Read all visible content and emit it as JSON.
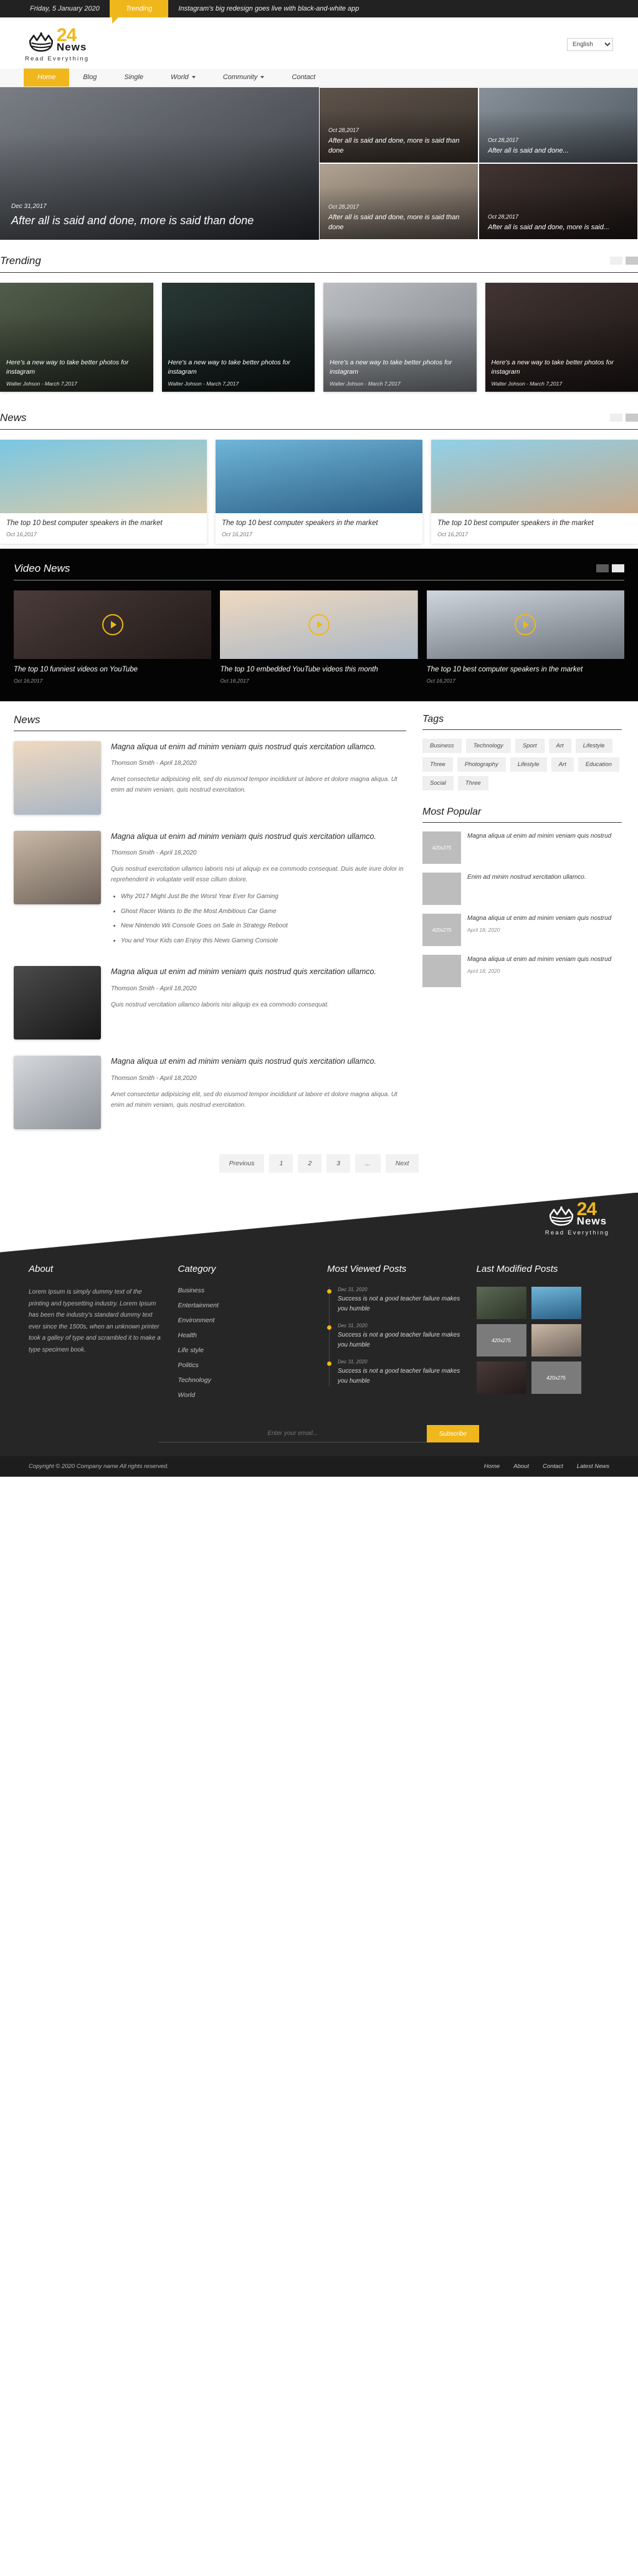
{
  "topbar": {
    "date": "Friday, 5 January 2020",
    "trending_label": "Trending",
    "headline": "Instagram's big redesign goes live with black-and-white app"
  },
  "brand": {
    "number": "24",
    "name": "News",
    "tagline": "Read Everything"
  },
  "language": {
    "selected": "English"
  },
  "nav": [
    {
      "label": "Home",
      "active": true,
      "caret": false
    },
    {
      "label": "Blog",
      "active": false,
      "caret": false
    },
    {
      "label": "Single",
      "active": false,
      "caret": false
    },
    {
      "label": "World",
      "active": false,
      "caret": true
    },
    {
      "label": "Community",
      "active": false,
      "caret": true
    },
    {
      "label": "Contact",
      "active": false,
      "caret": false
    }
  ],
  "hero": {
    "main": {
      "date": "Dec 31,2017",
      "title": "After all is said and done, more is said than done"
    },
    "cells": [
      {
        "date": "Oct 28,2017",
        "title": "After all is said and done, more is said than done"
      },
      {
        "date": "Oct 28,2017",
        "title": "After all is said and done..."
      },
      {
        "date": "Oct 28,2017",
        "title": "After all is said and done, more is said than done"
      },
      {
        "date": "Oct 28,2017",
        "title": "After all is said and done, more is said..."
      }
    ]
  },
  "trending": {
    "title": "Trending",
    "cards": [
      {
        "title": "Here's a new way to take better photos for instagram",
        "meta": "Walter Johson - March 7,2017"
      },
      {
        "title": "Here's a new way to take better photos for instagram",
        "meta": "Walter Johson - March 7,2017"
      },
      {
        "title": "Here's a new way to take better photos for instagram",
        "meta": "Walter Johson - March 7,2017"
      },
      {
        "title": "Here's a new way to take better photos for instagram",
        "meta": "Walter Johson - March 7,2017"
      }
    ]
  },
  "news": {
    "title": "News",
    "cards": [
      {
        "title": "The top 10 best computer speakers in the market",
        "date": "Oct 16,2017"
      },
      {
        "title": "The top 10 best computer speakers in the market",
        "date": "Oct 16,2017"
      },
      {
        "title": "The top 10 best computer speakers in the market",
        "date": "Oct 16,2017"
      }
    ]
  },
  "video_news": {
    "title": "Video News",
    "cards": [
      {
        "title": "The top 10 funniest videos on YouTube",
        "date": "Oct 16,2017"
      },
      {
        "title": "The top 10 embedded YouTube videos this month",
        "date": "Oct 16,2017"
      },
      {
        "title": "The top 10 best computer speakers in the market",
        "date": "Oct 16,2017"
      }
    ]
  },
  "blog": {
    "title": "News",
    "posts": [
      {
        "title": "Magna aliqua ut enim ad minim veniam quis nostrud quis xercitation ullamco.",
        "meta": "Thomson Smith - April 18,2020",
        "excerpt": "Amet consectetur adipisicing elit, sed do eiusmod tempor incididunt ut labore et dolore magna aliqua. Ut enim ad minim veniam, quis nostrud exercitation.",
        "list": []
      },
      {
        "title": "Magna aliqua ut enim ad minim veniam quis nostrud quis xercitation ullamco.",
        "meta": "Thomson Smith - April 18,2020",
        "excerpt": "Quis nostrud exercitation ullamco laboris nisi ut aliquip ex ea commodo consequat. Duis aute irure dolor in reprehenderit in voluptate velit esse cillum dolore.",
        "list": [
          "Why 2017 Might Just Be the Worst Year Ever for Gaming",
          "Ghost Racer Wants to Be the Most Ambitious Car Game",
          "New Nintendo Wii Console Goes on Sale in Strategy Reboot",
          "You and Your Kids can Enjoy this News Gaming Console"
        ]
      },
      {
        "title": "Magna aliqua ut enim ad minim veniam quis nostrud quis xercitation ullamco.",
        "meta": "Thomson Smith - April 18,2020",
        "excerpt": "Quis nostrud vercitation ullamco laboris nisi aliquip ex ea commodo consequat.",
        "list": []
      },
      {
        "title": "Magna aliqua ut enim ad minim veniam quis nostrud quis xercitation ullamco.",
        "meta": "Thomson Smith - April 18,2020",
        "excerpt": "Amet consectetur adipisicing elit, sed do eiusmod tempor incididunt ut labore et dolore magna aliqua. Ut enim ad minim veniam, quis nostrud exercitation.",
        "list": []
      }
    ]
  },
  "sidebar": {
    "tags_title": "Tags",
    "tags": [
      "Business",
      "Technology",
      "Sport",
      "Art",
      "Lifestyle",
      "Three",
      "Photography",
      "Lifestyle",
      "Art",
      "Education",
      "Social",
      "Three"
    ],
    "popular_title": "Most Popular",
    "popular": [
      {
        "thumb": "420x275",
        "title": "Magna aliqua ut enim ad minim veniam quis nostrud",
        "date": ""
      },
      {
        "thumb": "",
        "title": "Enim ad minim nostrud xercitation ullamco.",
        "date": ""
      },
      {
        "thumb": "420x275",
        "title": "Magna aliqua ut enim ad minim veniam quis nostrud",
        "date": "April 18, 2020"
      },
      {
        "thumb": "",
        "title": "Magna aliqua ut enim ad minim veniam quis nostrud",
        "date": "April 18, 2020"
      }
    ]
  },
  "pagination": [
    "Previous",
    "1",
    "2",
    "3",
    "...",
    "Next"
  ],
  "footer": {
    "about_title": "About",
    "about_text": "Lorem Ipsum is simply dummy text of the printing and typesetting industry. Lorem Ipsum has been the industry's standard dummy text ever since the 1500s, when an unknown printer took a galley of type and scrambled it to make a type specimen book.",
    "category_title": "Category",
    "categories": [
      "Business",
      "Entertainment",
      "Environment",
      "Health",
      "Life style",
      "Politics",
      "Technology",
      "World"
    ],
    "most_viewed_title": "Most Viewed Posts",
    "most_viewed": [
      {
        "date": "Dec 31, 2020",
        "title": "Success is not a good teacher failure makes you humble"
      },
      {
        "date": "Dec 31, 2020",
        "title": "Success is not a good teacher failure makes you humble"
      },
      {
        "date": "Dec 31, 2020",
        "title": "Success is not a good teacher failure makes you humble"
      }
    ],
    "last_modified_title": "Last Modified Posts",
    "last_modified": [
      "",
      "",
      "420x275",
      "",
      "",
      "420x275"
    ],
    "newsletter_placeholder": "Enter your email...",
    "subscribe_label": "Subscribe",
    "copyright": "Copyright © 2020 Company name All rights reserved.",
    "links": [
      "Home",
      "About",
      "Contact",
      "Latest News"
    ]
  },
  "colors": {
    "accent": "#f0b71c",
    "dark": "#222222",
    "footer": "#262626"
  }
}
